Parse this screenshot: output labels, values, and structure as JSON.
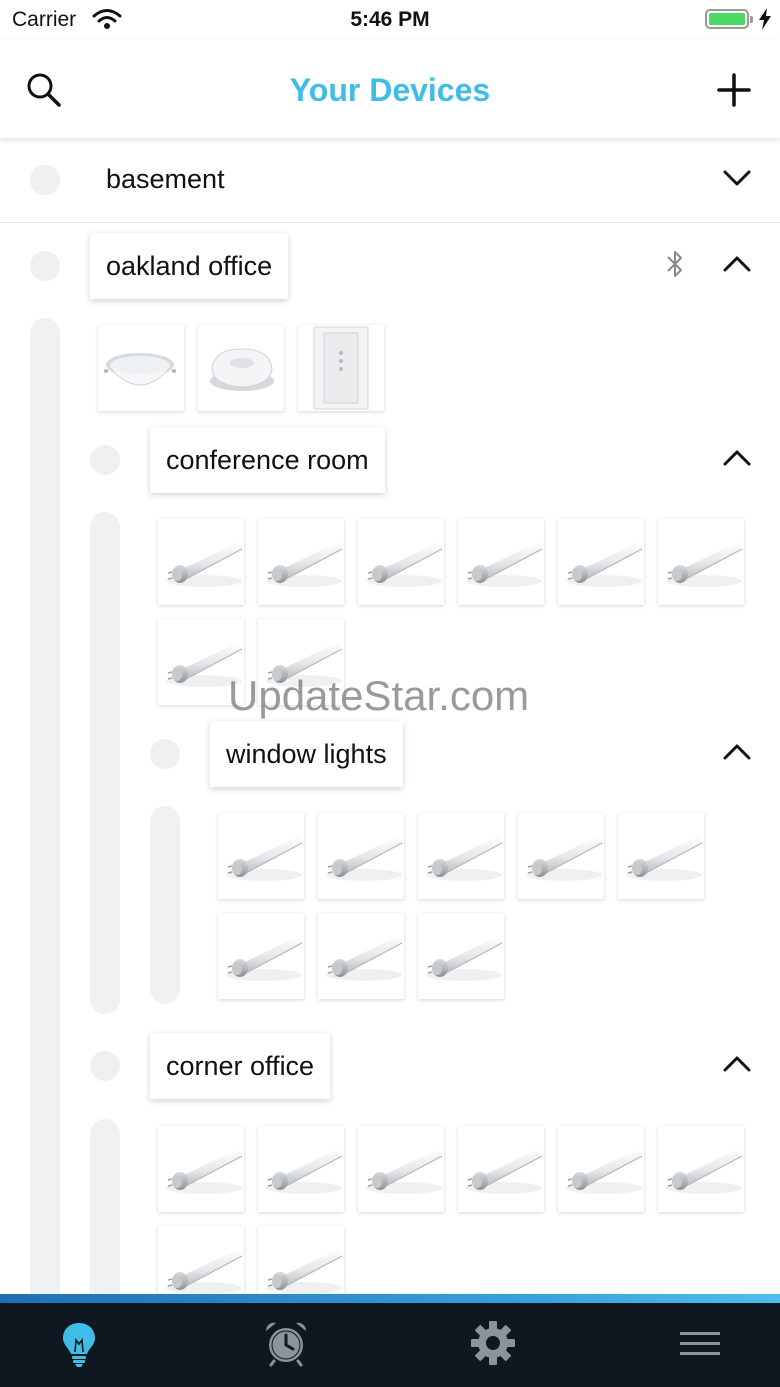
{
  "status_bar": {
    "carrier": "Carrier",
    "time": "5:46 PM"
  },
  "header": {
    "title": "Your Devices",
    "search_icon": "search-icon",
    "add_icon": "plus-icon"
  },
  "groups": {
    "basement": {
      "label": "basement",
      "expanded": false
    },
    "oakland_office": {
      "label": "oakland office",
      "expanded": true,
      "bluetooth_icon": "bluetooth-icon",
      "devices": [
        "downlight",
        "hub",
        "wall-switch"
      ]
    },
    "conference_room": {
      "label": "conference room",
      "expanded": true,
      "device_count": 8,
      "device_type": "led-tube"
    },
    "window_lights": {
      "label": "window lights",
      "expanded": true,
      "device_count": 8,
      "device_type": "led-tube"
    },
    "corner_office": {
      "label": "corner office",
      "expanded": true,
      "device_count": 8,
      "device_type": "led-tube"
    }
  },
  "watermark": "UpdateStar.com",
  "tabbar": {
    "items": [
      {
        "icon": "lightbulb-icon",
        "active": true
      },
      {
        "icon": "alarm-clock-icon",
        "active": false
      },
      {
        "icon": "gear-icon",
        "active": false
      },
      {
        "icon": "menu-icon",
        "active": false
      }
    ],
    "active_color": "#3fbde6",
    "inactive_color": "#8a949c"
  },
  "colors": {
    "accent": "#3fbde6",
    "tabbar_bg": "#0f1820",
    "battery": "#4cd964"
  }
}
